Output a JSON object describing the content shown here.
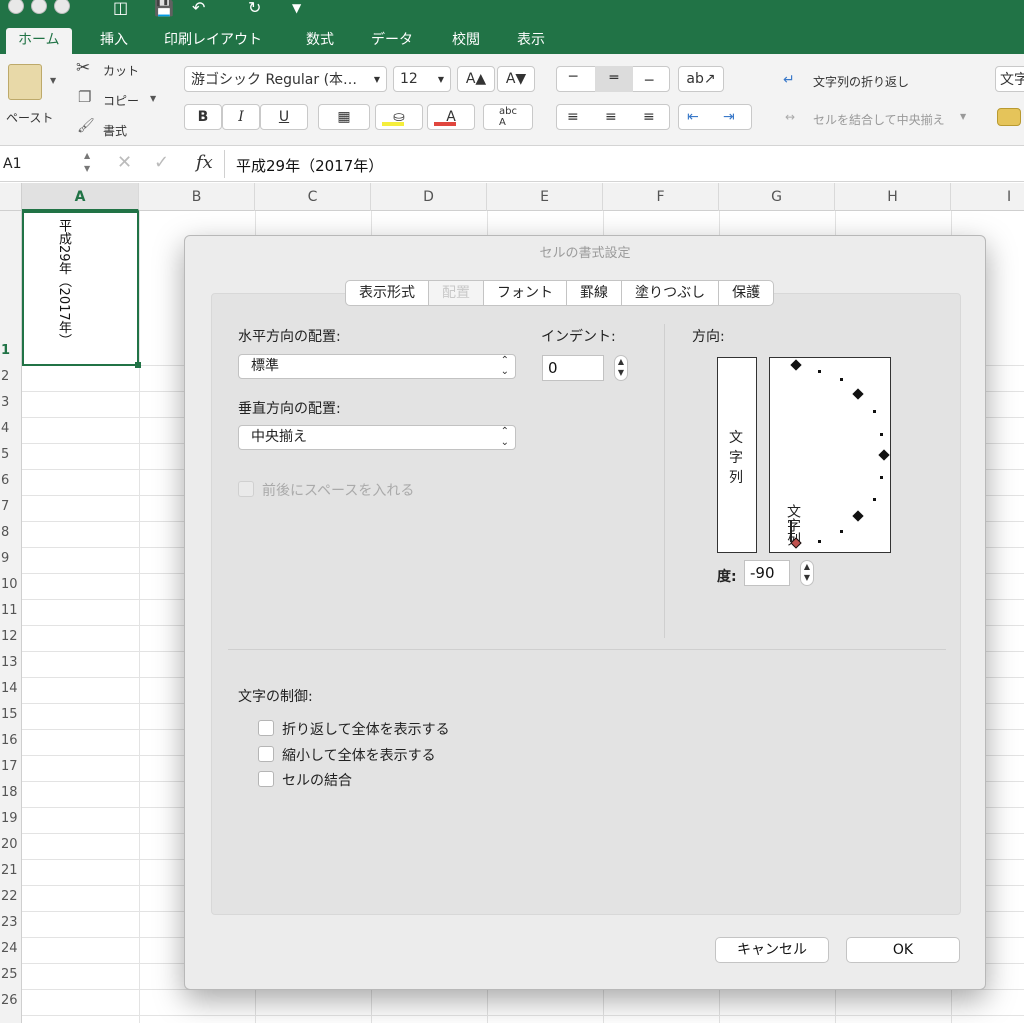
{
  "ribbon_tabs": [
    "ホーム",
    "挿入",
    "印刷レイアウト",
    "数式",
    "データ",
    "校閲",
    "表示"
  ],
  "ribbon": {
    "paste_label": "ペースト",
    "cut_label": "カット",
    "copy_label": "コピー",
    "format_painter_label": "書式",
    "font_name": "游ゴシック Regular (本…",
    "font_size": "12",
    "wrap_text_label": "文字列の折り返し",
    "merge_center_label": "セルを結合して中央揃え",
    "number_format_partial": "文字"
  },
  "formula_bar": {
    "name_box": "A1",
    "fx_label": "fx",
    "content": "平成29年（2017年）"
  },
  "grid": {
    "columns": [
      "A",
      "B",
      "C",
      "D",
      "E",
      "F",
      "G",
      "H",
      "I"
    ],
    "rows": [
      "1",
      "2",
      "3",
      "4",
      "5",
      "6",
      "7",
      "8",
      "9",
      "10",
      "11",
      "12",
      "13",
      "14",
      "15",
      "16",
      "17",
      "18",
      "19",
      "20",
      "21",
      "22",
      "23",
      "24",
      "25",
      "26"
    ],
    "cell_a1_text": "平成29年（2017年）"
  },
  "dialog": {
    "title": "セルの書式設定",
    "tabs": [
      "表示形式",
      "配置",
      "フォント",
      "罫線",
      "塗りつぶし",
      "保護"
    ],
    "active_tab": "配置",
    "horizontal_label": "水平方向の配置:",
    "horizontal_value": "標準",
    "indent_label": "インデント:",
    "indent_value": "0",
    "vertical_label": "垂直方向の配置:",
    "vertical_value": "中央揃え",
    "justify_distributed_label": "前後にスペースを入れる",
    "orientation_label": "方向:",
    "vertical_text_sample": "文字列",
    "rotated_text_sample": "文字列",
    "degree_label": "度:",
    "degree_value": "-90",
    "text_control_label": "文字の制御:",
    "wrap_text_checkbox": "折り返して全体を表示する",
    "shrink_to_fit_checkbox": "縮小して全体を表示する",
    "merge_cells_checkbox": "セルの結合",
    "cancel_button": "キャンセル",
    "ok_button": "OK"
  },
  "colors": {
    "excel_green": "#217346",
    "font_color_bar": "#e0463e",
    "fill_color_bar": "#f5ee3c"
  }
}
